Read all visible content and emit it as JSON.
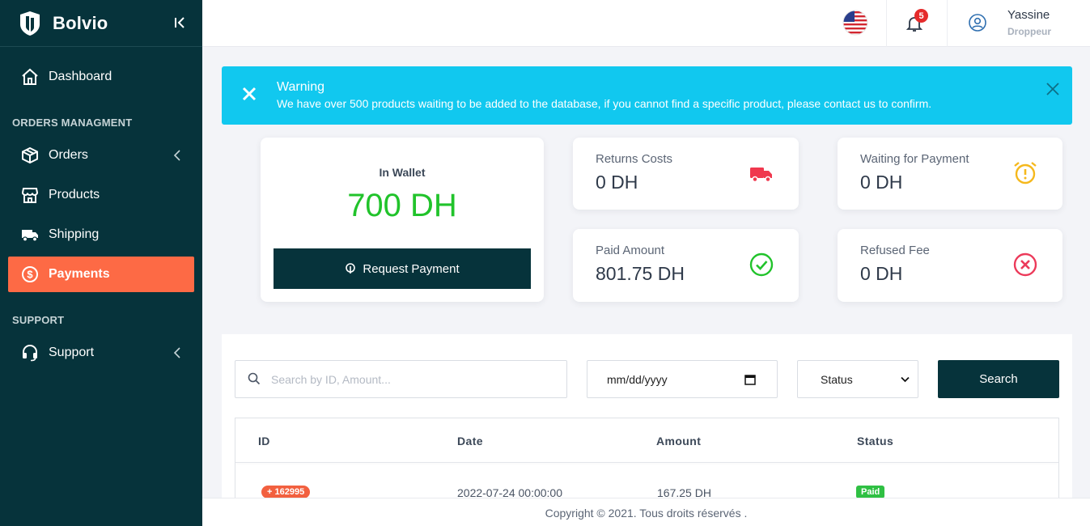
{
  "brand": {
    "name": "Bolvio",
    "logo_icon": "shield-logo-icon",
    "collapse_icon": "collapse-sidebar-icon"
  },
  "sidebar": {
    "dashboard": {
      "label": "Dashboard",
      "icon": "home-icon"
    },
    "orders_section": "ORDERS MANAGMENT",
    "orders": {
      "label": "Orders",
      "icon": "box-icon"
    },
    "products": {
      "label": "Products",
      "icon": "store-icon"
    },
    "shipping": {
      "label": "Shipping",
      "icon": "truck-icon"
    },
    "payments": {
      "label": "Payments",
      "icon": "dollar-icon"
    },
    "support_section": "SUPPORT",
    "support": {
      "label": "Support",
      "icon": "headset-icon"
    }
  },
  "topbar": {
    "flag_icon": "us-flag-icon",
    "notifications_count": "5",
    "user": {
      "name": "Yassine",
      "role": "Droppeur"
    }
  },
  "alert": {
    "title": "Warning",
    "message": "We have over 500 products waiting to be added to the database, if you cannot find a specific product, please contact us to confirm."
  },
  "wallet": {
    "label": "In Wallet",
    "amount": "700 DH",
    "button_label": "Request Payment"
  },
  "stats": {
    "returns": {
      "label": "Returns Costs",
      "value": "0 DH"
    },
    "waiting": {
      "label": "Waiting for Payment",
      "value": "0 DH"
    },
    "paid": {
      "label": "Paid Amount",
      "value": "801.75 DH"
    },
    "refused": {
      "label": "Refused Fee",
      "value": "0 DH"
    }
  },
  "filters": {
    "search_placeholder": "Search by ID, Amount...",
    "date_placeholder": "mm/dd/yyyy",
    "status_selected": "Status",
    "search_button": "Search"
  },
  "table": {
    "headers": {
      "id": "ID",
      "date": "Date",
      "amount": "Amount",
      "status": "Status"
    },
    "rows": [
      {
        "id": "+ 162995",
        "date": "2022-07-24 00:00:00",
        "amount": "167.25 DH",
        "status": "Paid"
      }
    ]
  },
  "footer": {
    "text": "Copyright © 2021. Tous droits réservés ."
  },
  "colors": {
    "sidebar": "#06333b",
    "accent": "#fd6a45",
    "alert": "#11c8ef",
    "wallet_amount": "#21c32b"
  }
}
